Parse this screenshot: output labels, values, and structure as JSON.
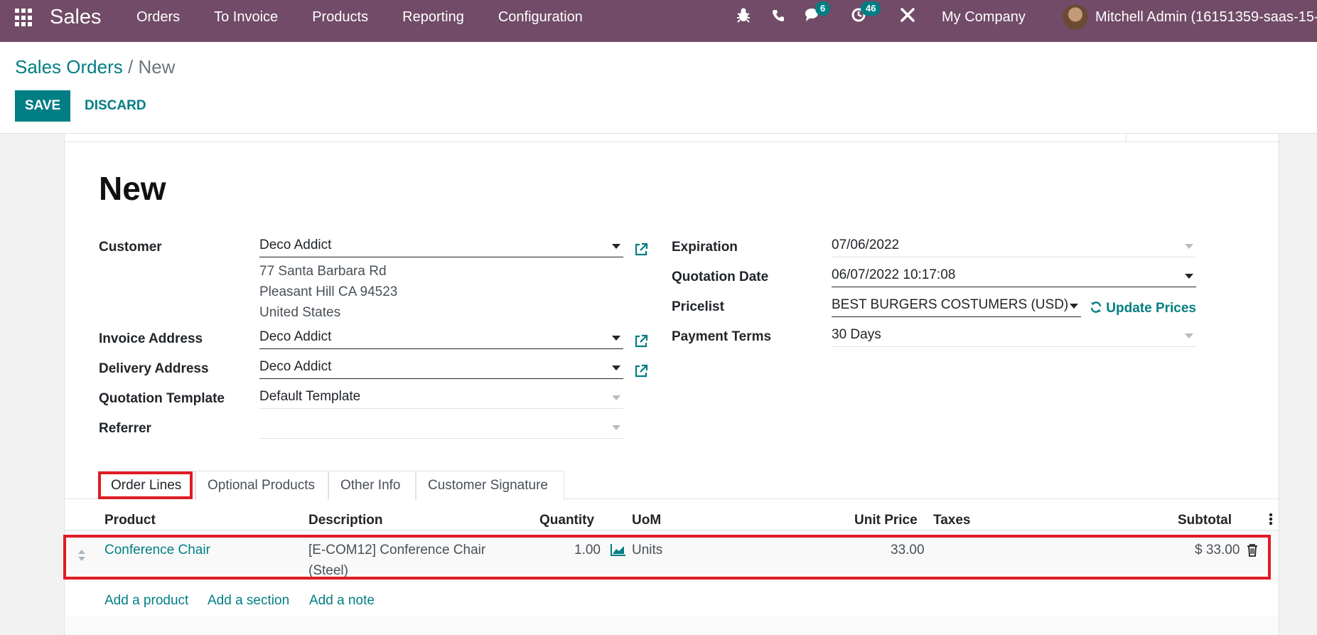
{
  "navbar": {
    "app_name": "Sales",
    "menu": [
      "Orders",
      "To Invoice",
      "Products",
      "Reporting",
      "Configuration"
    ],
    "chat_count": "6",
    "activity_count": "46",
    "company": "My Company",
    "user": "Mitchell Admin (16151359-saas-15-1"
  },
  "breadcrumb": {
    "parent": "Sales Orders",
    "separator": "/",
    "current": "New"
  },
  "buttons": {
    "save": "SAVE",
    "discard": "DISCARD"
  },
  "form": {
    "title": "New",
    "left": {
      "customer_label": "Customer",
      "customer_value": "Deco Addict",
      "address": [
        "77 Santa Barbara Rd",
        "Pleasant Hill CA 94523",
        "United States"
      ],
      "invoice_label": "Invoice Address",
      "invoice_value": "Deco Addict",
      "delivery_label": "Delivery Address",
      "delivery_value": "Deco Addict",
      "template_label": "Quotation Template",
      "template_value": "Default Template",
      "referrer_label": "Referrer",
      "referrer_value": ""
    },
    "right": {
      "expiration_label": "Expiration",
      "expiration_value": "07/06/2022",
      "quotation_date_label": "Quotation Date",
      "quotation_date_value": "06/07/2022 10:17:08",
      "pricelist_label": "Pricelist",
      "pricelist_value": "BEST BURGERS COSTUMERS (USD)",
      "update_prices": "Update Prices",
      "payment_terms_label": "Payment Terms",
      "payment_terms_value": "30 Days"
    }
  },
  "tabs": [
    "Order Lines",
    "Optional Products",
    "Other Info",
    "Customer Signature"
  ],
  "order_lines": {
    "headers": {
      "product": "Product",
      "description": "Description",
      "quantity": "Quantity",
      "uom": "UoM",
      "unit_price": "Unit Price",
      "taxes": "Taxes",
      "subtotal": "Subtotal"
    },
    "rows": [
      {
        "product": "Conference Chair",
        "description_line1": "[E-COM12] Conference Chair",
        "description_line2": "(Steel)",
        "quantity": "1.00",
        "uom": "Units",
        "unit_price": "33.00",
        "taxes": "",
        "subtotal": "$ 33.00"
      }
    ],
    "add_product": "Add a product",
    "add_section": "Add a section",
    "add_note": "Add a note"
  },
  "colors": {
    "navbar": "#714b67",
    "accent": "#017e84",
    "highlight": "#e01b24"
  }
}
